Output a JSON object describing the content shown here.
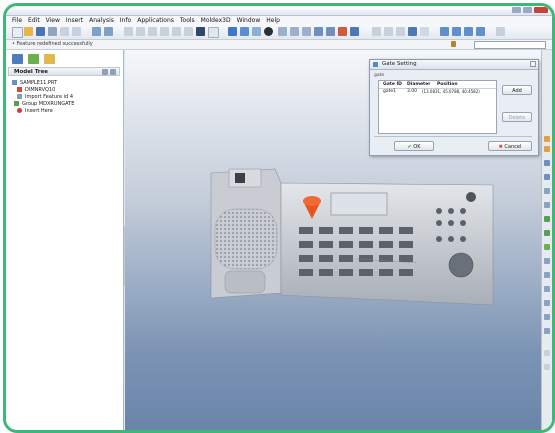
{
  "menu": [
    "File",
    "Edit",
    "View",
    "Insert",
    "Analysis",
    "Info",
    "Applications",
    "Tools",
    "Moldex3D",
    "Window",
    "Help"
  ],
  "status_message": "• Feature redefined successfully",
  "model_tree": {
    "title": "Model Tree",
    "items": [
      "SAMPLE11.PRT",
      "DIMNRVQ10",
      "Import Feature id 4",
      "Group MDXRUNGATE",
      "Insert Here"
    ]
  },
  "dialog": {
    "title": "Gate Setting",
    "group_label": "gate",
    "columns": [
      "Gate ID",
      "Diameter",
      "Position"
    ],
    "row": {
      "gate_id": "gate1",
      "diameter": "3.00",
      "position": "(13.0831, 45.0788, 40.4582)"
    },
    "add_label": "Add",
    "delete_label": "Delete",
    "ok_label": "OK",
    "cancel_label": "Cancel"
  },
  "colors": {
    "frame": "#3cb878",
    "gate_marker": "#e9531e",
    "viewport_bottom": "#6a85aa"
  }
}
